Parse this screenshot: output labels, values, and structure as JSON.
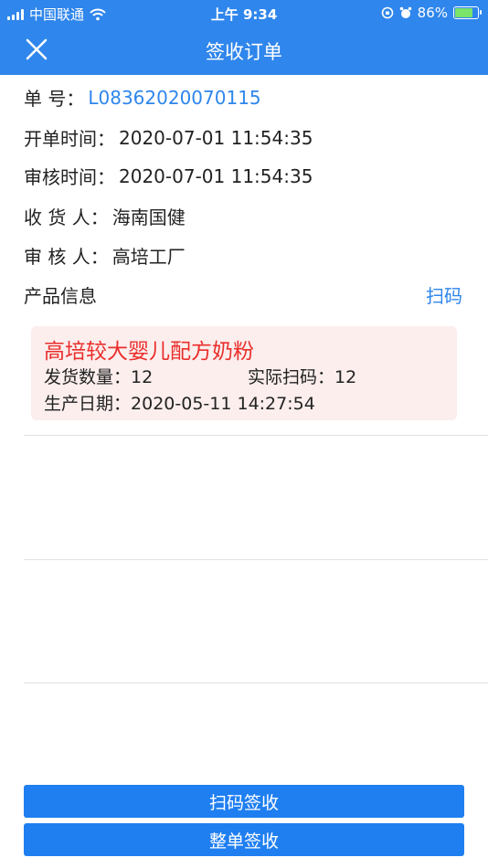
{
  "status_bar": {
    "carrier": "中国联通",
    "time": "上午 9:34",
    "battery": "86%",
    "icons": [
      "signal-icon",
      "wifi-icon",
      "orientation-lock-icon",
      "alarm-icon",
      "battery-icon"
    ]
  },
  "nav": {
    "title": "签收订单",
    "close_icon": "close-icon"
  },
  "order": {
    "number_label": "单 号：",
    "number_value": "L08362020070115",
    "open_time_label": "开单时间：",
    "open_time_value": "2020-07-01 11:54:35",
    "audit_time_label": "审核时间：",
    "audit_time_value": "2020-07-01 11:54:35",
    "receiver_label": "收 货 人：",
    "receiver_value": "海南国健",
    "auditor_label": "审 核 人：",
    "auditor_value": "高培工厂"
  },
  "products": {
    "section_label": "产品信息",
    "scan_link": "扫码",
    "items": [
      {
        "name": "高培较大婴儿配方奶粉",
        "ship_qty_label": "发货数量：",
        "ship_qty": "12",
        "actual_scan_label": "实际扫码：",
        "actual_scan": "12",
        "prod_date_label": "生产日期：",
        "prod_date": "2020-05-11 14:27:54"
      }
    ]
  },
  "buttons": {
    "scan_sign": "扫码签收",
    "whole_sign": "整单签收"
  },
  "colors": {
    "primary": "#2f86ec",
    "button": "#1f7ff1",
    "product_name": "#ea2e2b",
    "card_bg": "#fbeeed"
  }
}
